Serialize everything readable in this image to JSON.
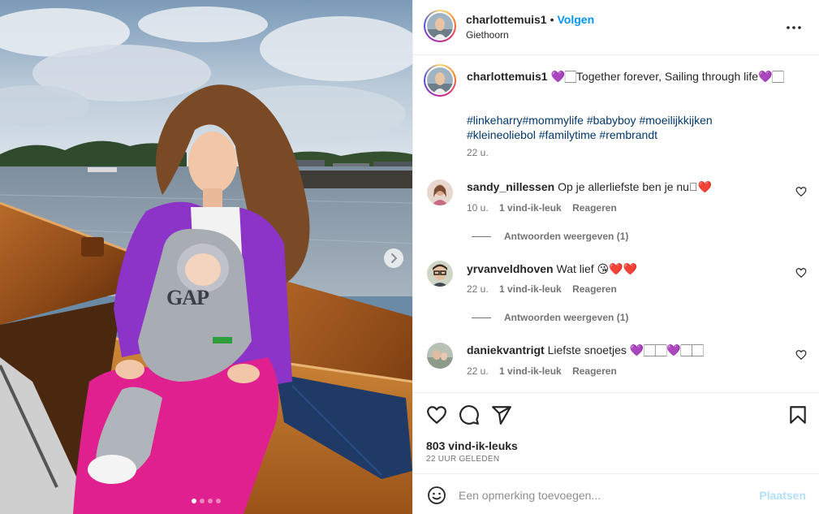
{
  "post": {
    "photo": {
      "carousel_count": 4,
      "active_index": 0,
      "next_icon": "chevron-right-icon",
      "shirt_logo": "GAP"
    },
    "header": {
      "username": "charlottemuis1",
      "separator": "•",
      "follow_label": "Volgen",
      "location": "Giethoorn",
      "more_icon": "more-horizontal-icon"
    },
    "caption": {
      "username": "charlottemuis1",
      "text": " 💜🏻Together forever, Sailing through life💜🏻",
      "hashtags": [
        "#linkeharry",
        "#mommylife",
        "#babyboy",
        "#moeilijkkijken",
        "#kleineoliebol",
        "#familytime",
        "#rembrandt"
      ],
      "time": "22 u."
    },
    "comments": [
      {
        "username": "sandy_nillessen",
        "text": "Op je allerliefste ben je nu🏻❤️",
        "time": "10 u.",
        "likes": "1 vind-ik-leuk",
        "reply_label": "Reageren",
        "view_replies": "Antwoorden weergeven (1)"
      },
      {
        "username": "yrvanveldhoven",
        "text": "Wat lief 😘❤️❤️",
        "time": "22 u.",
        "likes": "1 vind-ik-leuk",
        "reply_label": "Reageren",
        "view_replies": "Antwoorden weergeven (1)"
      },
      {
        "username": "daniekvantrigt",
        "text": "Liefste snoetjes 💜🏻🏻💜🏻🏻",
        "time": "22 u.",
        "likes": "1 vind-ik-leuk",
        "reply_label": "Reageren"
      }
    ],
    "actions": {
      "like_icon": "heart-icon",
      "comment_icon": "comment-icon",
      "share_icon": "share-icon",
      "save_icon": "bookmark-icon",
      "likes_count": "803 vind-ik-leuks",
      "time_ago": "22 UUR GELEDEN"
    },
    "comment_box": {
      "emoji_icon": "emoji-icon",
      "placeholder": "Een opmerking toevoegen...",
      "post_label": "Plaatsen"
    },
    "colors": {
      "follow_blue": "#0095f6",
      "hashtag_blue": "#00376b",
      "post_disabled": "#b2dffc",
      "heart_red": "#ed4956",
      "purple_cardigan": "#8b34c7",
      "pink_pants": "#e0208e"
    }
  }
}
